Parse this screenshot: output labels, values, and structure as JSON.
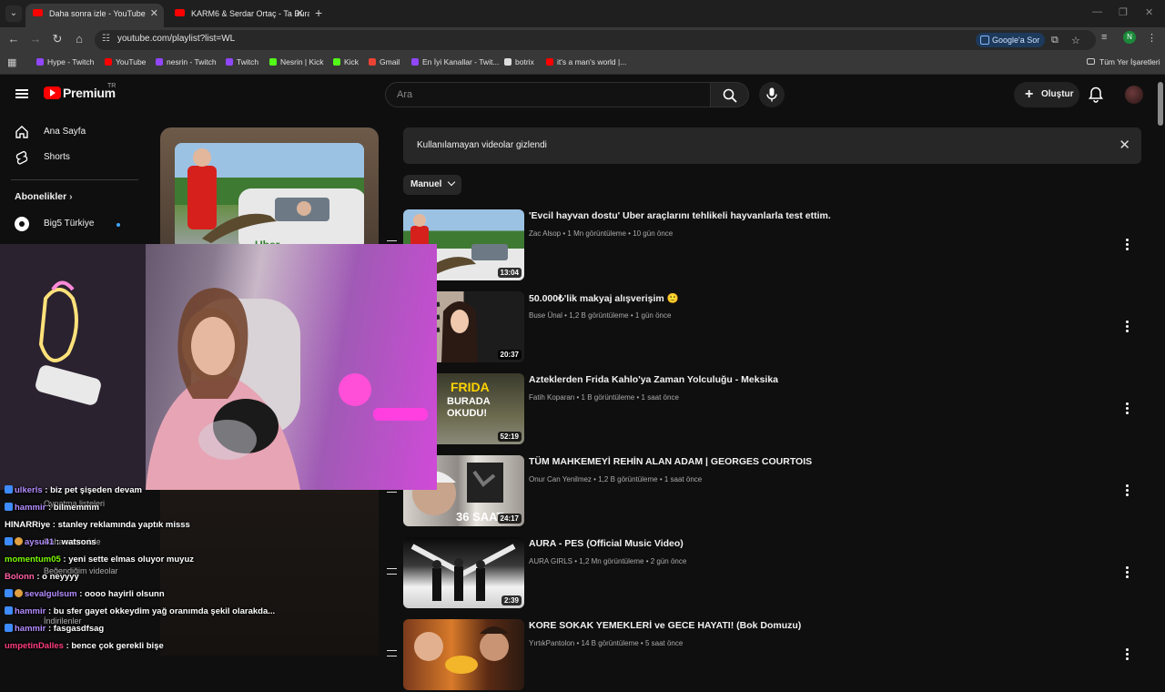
{
  "browser": {
    "tabs": [
      {
        "title": "Daha sonra izle - YouTube",
        "active": true
      },
      {
        "title": "KARM6 & Serdar Ortaç - Ta Bura",
        "active": false
      }
    ],
    "url": "youtube.com/playlist?list=WL",
    "google_ask": "Google'a Sor",
    "profile_initial": "N",
    "bookmarks": [
      {
        "label": "Hype - Twitch",
        "color": "#9146ff"
      },
      {
        "label": "YouTube",
        "color": "#ff0000"
      },
      {
        "label": "nesrin - Twitch",
        "color": "#9146ff"
      },
      {
        "label": "Twitch",
        "color": "#9146ff"
      },
      {
        "label": "Nesrin | Kick",
        "color": "#53fc18"
      },
      {
        "label": "Kick",
        "color": "#53fc18"
      },
      {
        "label": "Gmail",
        "color": "#ea4335"
      },
      {
        "label": "En İyi Kanallar - Twit...",
        "color": "#9146ff"
      },
      {
        "label": "botrix",
        "color": "#dddddd"
      },
      {
        "label": "it's a man's world |...",
        "color": "#ff0000"
      }
    ],
    "all_bookmarks": "Tüm Yer İşaretleri"
  },
  "youtube": {
    "logo_text": "Premium",
    "country_code": "TR",
    "search_placeholder": "Ara",
    "create_label": "Oluştur",
    "sidebar": {
      "home": "Ana Sayfa",
      "shorts": "Shorts",
      "subscriptions_heading": "Abonelikler",
      "subscription_1": "Big5 Türkiye",
      "ghost_items": [
        "Oynatma listeleri",
        "Daha sonra izle",
        "Beğendiğim videolar",
        "İndirilenler"
      ]
    },
    "banner_text": "Kullanılamayan videolar gizlendi",
    "sort_label": "Manuel",
    "videos": [
      {
        "title": "'Evcil hayvan dostu' Uber araçlarını tehlikeli hayvanlarla test ettim.",
        "channel": "Zac Alsop",
        "views": "1 Mn görüntüleme",
        "age": "10 gün önce",
        "duration": "13:04"
      },
      {
        "title": "50.000₺'lik makyaj alışverişim 🙂",
        "channel": "Buse Ünal",
        "views": "1,2 B görüntüleme",
        "age": "1 gün önce",
        "duration": "20:37"
      },
      {
        "title": "Azteklerden Frida Kahlo'ya Zaman Yolculuğu - Meksika",
        "channel": "Fatih Koparan",
        "views": "1 B görüntüleme",
        "age": "1 saat önce",
        "duration": "52:19"
      },
      {
        "title": "TÜM MAHKEMEYİ REHİN ALAN ADAM | GEORGES COURTOIS",
        "channel": "Onur Can Yenilmez",
        "views": "1,2 B görüntüleme",
        "age": "1 saat önce",
        "duration": "24:17"
      },
      {
        "title": "AURA - PES (Official Music Video)",
        "channel": "AURA GIRLS",
        "views": "1,2 Mn görüntüleme",
        "age": "2 gün önce",
        "duration": "2:39"
      },
      {
        "title": "KORE SOKAK YEMEKLERİ ve GECE HAYATI! (Bok Domuzu)",
        "channel": "YırtıkPantolon",
        "views": "14 B görüntüleme",
        "age": "5 saat önce",
        "duration": ""
      }
    ],
    "meta_separator": "•"
  },
  "stream_chat": [
    {
      "user": "ulkerls",
      "msg": ": biz pet şişeden devam",
      "color": "#b48cff"
    },
    {
      "user": "hammir",
      "msg": ": bilmemmm",
      "color": "#b48cff"
    },
    {
      "user": "HINARRiye",
      "msg": ": stanley reklamında yaptık misss",
      "color": "#ffffff"
    },
    {
      "user": "aysu41",
      "msg": ": watsons",
      "color": "#b48cff"
    },
    {
      "user": "momentum05",
      "msg": ": yeni sette elmas oluyor muyuz",
      "color": "#7cfc00"
    },
    {
      "user": "Bolonn",
      "msg": ": o neyyyy",
      "color": "#ff5fa2"
    },
    {
      "user": "sevalgulsum",
      "msg": ": oooo hayirli olsunn",
      "color": "#b48cff"
    },
    {
      "user": "hammir",
      "msg": ": bu sfer gayet okkeydim yağ oranımda şekil olarakda...",
      "color": "#b48cff"
    },
    {
      "user": "hammir",
      "msg": ": fasgasdfsag",
      "color": "#b48cff"
    },
    {
      "user": "umpetinDalles",
      "msg": ": bence çok gerekli bişe",
      "color": "#ff3b7f"
    }
  ]
}
